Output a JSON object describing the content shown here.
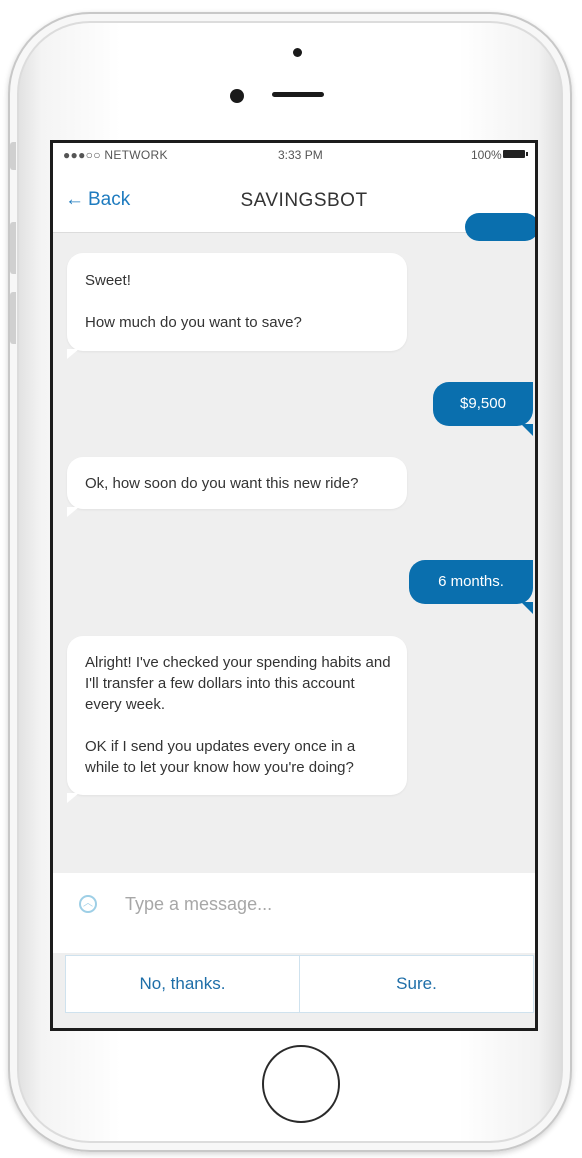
{
  "status_bar": {
    "carrier": "●●●○○ NETWORK",
    "time": "3:33 PM",
    "battery": "100%"
  },
  "nav": {
    "back_label": "Back",
    "title": "SAVINGSBOT"
  },
  "messages": [
    {
      "sender": "bot",
      "lines": [
        "Sweet!",
        "How much do you want to save?"
      ]
    },
    {
      "sender": "user",
      "text": "$9,500"
    },
    {
      "sender": "bot",
      "lines": [
        "Ok, how soon do you want this new ride?"
      ]
    },
    {
      "sender": "user",
      "text": "6 months."
    },
    {
      "sender": "bot",
      "lines": [
        "Alright!  I've checked your spending habits and I'll transfer a few dollars into this account every week.",
        "OK if I send you updates every once in a while to let your know how you're doing?"
      ]
    }
  ],
  "composer": {
    "placeholder": "Type a message..."
  },
  "quick_replies": [
    {
      "label": "No, thanks."
    },
    {
      "label": "Sure."
    }
  ],
  "colors": {
    "accent": "#0a6fae",
    "link": "#1e7bbf",
    "chat_background": "#efefef"
  }
}
